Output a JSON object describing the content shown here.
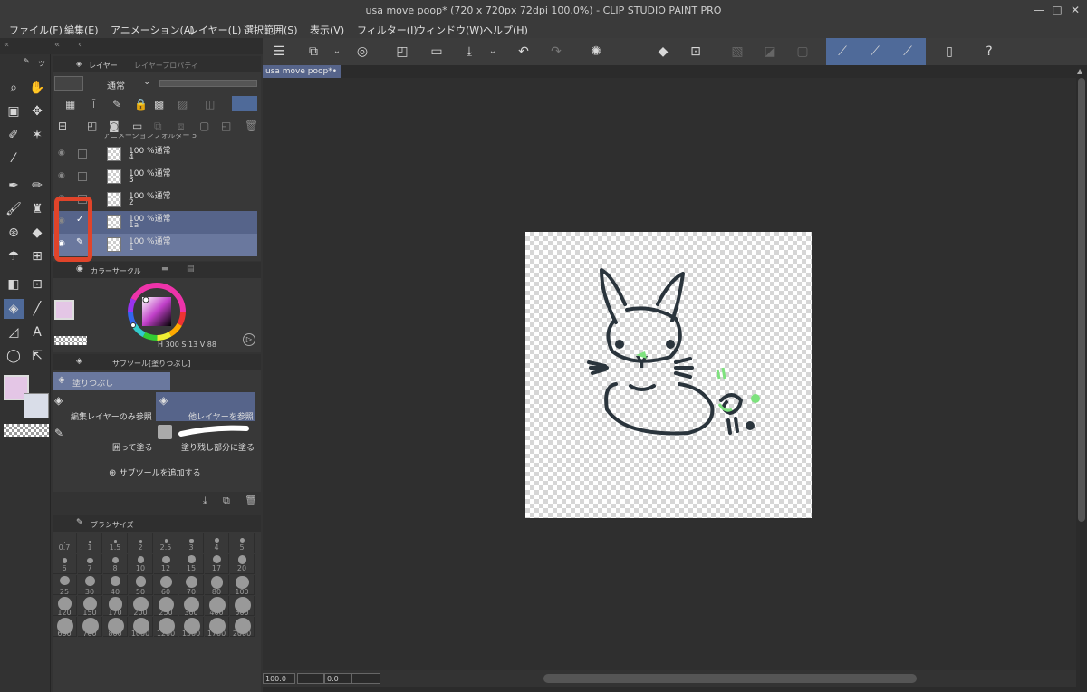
{
  "window": {
    "title": "usa move poop* (720 x 720px 72dpi 100.0%) - CLIP STUDIO PAINT PRO",
    "minimize": "—",
    "maximize": "□",
    "close": "✕"
  },
  "menu": [
    "ファイル(F)",
    "編集(E)",
    "アニメーション(A)",
    "レイヤー(L)",
    "選択範囲(S)",
    "表示(V)",
    "フィルター(I)",
    "ウィンドウ(W)",
    "ヘルプ(H)"
  ],
  "tool_tab": "ツ",
  "layer_panel": {
    "tab_layer": "レイヤー",
    "tab_property": "レイヤープロパティ",
    "blend_mode": "通常",
    "partial_row": "アニメーションフォルダー 5",
    "layers": [
      {
        "opacity": "100 %",
        "mode": "通常",
        "name": "4",
        "selected": false,
        "checked": false
      },
      {
        "opacity": "100 %",
        "mode": "通常",
        "name": "3",
        "selected": false,
        "checked": false
      },
      {
        "opacity": "100 %",
        "mode": "通常",
        "name": "2",
        "selected": false,
        "checked": false
      },
      {
        "opacity": "100 %",
        "mode": "通常",
        "name": "1a",
        "selected": true,
        "checked": true
      },
      {
        "opacity": "100 %",
        "mode": "通常",
        "name": "1",
        "selected": true,
        "checked": false
      }
    ]
  },
  "color_panel": {
    "tab": "カラーサークル",
    "h": "300",
    "h_label": "S",
    "s": "13",
    "s_label": "V",
    "v": "88",
    "h_prefix": "H"
  },
  "subtool_panel": {
    "tab": "サブツール[塗りつぶし]",
    "active": "塗りつぶし",
    "items": [
      "編集レイヤーのみ参照",
      "他レイヤーを参照",
      "囲って塗る",
      "塗り残し部分に塗る"
    ],
    "add_button": "サブツールを追加する"
  },
  "brush_panel": {
    "tab": "ブラシサイズ",
    "sizes": [
      "0.7",
      "1",
      "1.5",
      "2",
      "2.5",
      "3",
      "4",
      "5",
      "6",
      "7",
      "8",
      "10",
      "12",
      "15",
      "17",
      "20",
      "25",
      "30",
      "40",
      "50",
      "60",
      "70",
      "80",
      "100",
      "120",
      "150",
      "170",
      "200",
      "250",
      "300",
      "400",
      "500",
      "600",
      "700",
      "800",
      "1000",
      "1200",
      "1500",
      "1700",
      "2000"
    ]
  },
  "doc_tab": "usa move poop*",
  "status": {
    "zoom": "100.0",
    "rotate": "0.0"
  },
  "colors": {
    "accent": "#4f6a99",
    "main_color": "#e4c6e6",
    "sub_color": "#d9dde8",
    "highlight": "#e0442a",
    "line": "#2a343c",
    "green": "#7ee27e"
  }
}
